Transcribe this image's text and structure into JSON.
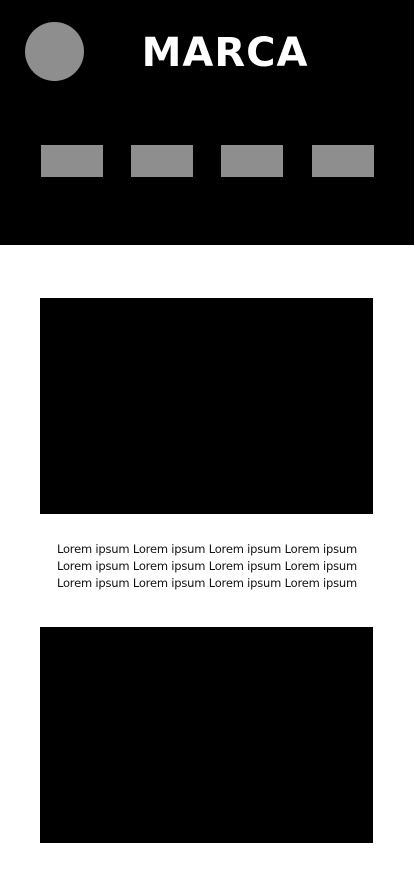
{
  "header": {
    "brand": "MARCA",
    "logo_icon": "placeholder-circle-icon",
    "background_color": "#000000",
    "placeholder_color": "#8e8e8e"
  },
  "main": {
    "paragraph_lines": [
      "Lorem ipsum Lorem ipsum Lorem ipsum Lorem ipsum",
      "Lorem ipsum Lorem ipsum Lorem ipsum Lorem ipsum",
      "Lorem ipsum Lorem ipsum Lorem ipsum Lorem ipsum"
    ]
  }
}
